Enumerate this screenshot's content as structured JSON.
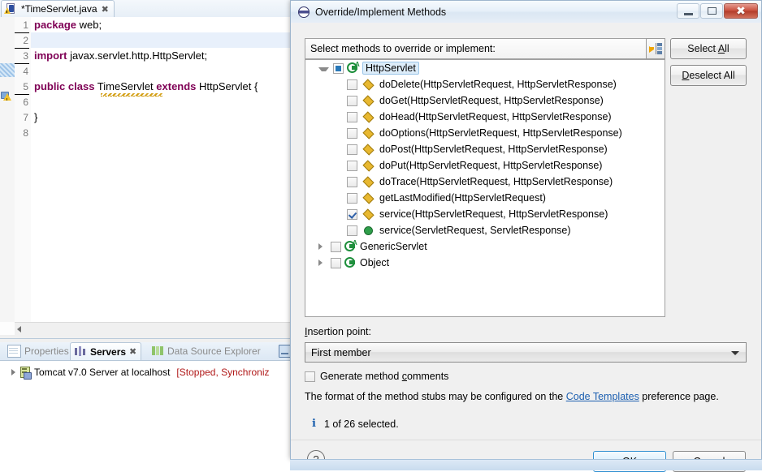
{
  "editor": {
    "tab": {
      "label": "*TimeServlet.java",
      "close_glyph": "✖",
      "icon": "java-file-warning-icon"
    },
    "line_numbers": [
      "1",
      "2",
      "3",
      "4",
      "5",
      "6",
      "7",
      "8"
    ],
    "lines": [
      {
        "n": 1,
        "tokens": [
          {
            "t": "package",
            "k": "kw"
          },
          {
            "t": " web;",
            "k": "pl"
          }
        ]
      },
      {
        "n": 2,
        "tokens": []
      },
      {
        "n": 3,
        "tokens": [
          {
            "t": "import",
            "k": "kw"
          },
          {
            "t": " javax.servlet.http.HttpServlet;",
            "k": "pl"
          }
        ]
      },
      {
        "n": 4,
        "tokens": []
      },
      {
        "n": 5,
        "tokens": [
          {
            "t": "public class",
            "k": "kw"
          },
          {
            "t": " TimeServlet ",
            "k": "pl"
          },
          {
            "t": "extends",
            "k": "kw"
          },
          {
            "t": " HttpServlet {",
            "k": "pl"
          }
        ]
      },
      {
        "n": 6,
        "tokens": []
      },
      {
        "n": 7,
        "tokens": [
          {
            "t": "}",
            "k": "pl"
          }
        ]
      },
      {
        "n": 8,
        "tokens": []
      }
    ],
    "keyword_color": "#7f0055",
    "plain_color": "#000000"
  },
  "views": {
    "tabs": [
      {
        "label": "Properties",
        "icon": "properties-icon",
        "active": false
      },
      {
        "label": "Servers",
        "icon": "servers-icon",
        "active": true,
        "close_glyph": "✖"
      },
      {
        "label": "Data Source Explorer",
        "icon": "data-source-explorer-icon",
        "active": false
      },
      {
        "label": "",
        "icon": "console-icon",
        "active": false
      }
    ],
    "server_row": {
      "name": "Tomcat v7.0 Server at localhost",
      "status": "[Stopped, Synchroniz",
      "status_color": "#b01818"
    }
  },
  "dialog": {
    "title": "Override/Implement Methods",
    "window_buttons": {
      "minimize": "minimize-button",
      "maximize": "maximize-button",
      "close_glyph": "✖"
    },
    "tree_header_label": "Select methods to override or implement:",
    "link_button_name": "link-with-editor-button",
    "select_all_label": "Select All",
    "select_all_mnemonic": "A",
    "deselect_all_label": "Deselect All",
    "deselect_all_mnemonic": "D",
    "tree": [
      {
        "label": "HttpServlet",
        "kind": "class",
        "abstract": true,
        "indent": 0,
        "twisty": "open",
        "checkbox": "partial",
        "selected": true
      },
      {
        "label": "doDelete(HttpServletRequest, HttpServletResponse)",
        "kind": "method",
        "visibility": "protected",
        "indent": 1,
        "twisty": "none",
        "checkbox": "unchecked",
        "selected": false
      },
      {
        "label": "doGet(HttpServletRequest, HttpServletResponse)",
        "kind": "method",
        "visibility": "protected",
        "indent": 1,
        "twisty": "none",
        "checkbox": "unchecked",
        "selected": false
      },
      {
        "label": "doHead(HttpServletRequest, HttpServletResponse)",
        "kind": "method",
        "visibility": "protected",
        "indent": 1,
        "twisty": "none",
        "checkbox": "unchecked",
        "selected": false
      },
      {
        "label": "doOptions(HttpServletRequest, HttpServletResponse)",
        "kind": "method",
        "visibility": "protected",
        "indent": 1,
        "twisty": "none",
        "checkbox": "unchecked",
        "selected": false
      },
      {
        "label": "doPost(HttpServletRequest, HttpServletResponse)",
        "kind": "method",
        "visibility": "protected",
        "indent": 1,
        "twisty": "none",
        "checkbox": "unchecked",
        "selected": false
      },
      {
        "label": "doPut(HttpServletRequest, HttpServletResponse)",
        "kind": "method",
        "visibility": "protected",
        "indent": 1,
        "twisty": "none",
        "checkbox": "unchecked",
        "selected": false
      },
      {
        "label": "doTrace(HttpServletRequest, HttpServletResponse)",
        "kind": "method",
        "visibility": "protected",
        "indent": 1,
        "twisty": "none",
        "checkbox": "unchecked",
        "selected": false
      },
      {
        "label": "getLastModified(HttpServletRequest)",
        "kind": "method",
        "visibility": "protected",
        "indent": 1,
        "twisty": "none",
        "checkbox": "unchecked",
        "selected": false
      },
      {
        "label": "service(HttpServletRequest, HttpServletResponse)",
        "kind": "method",
        "visibility": "protected",
        "indent": 1,
        "twisty": "none",
        "checkbox": "checked",
        "selected": false
      },
      {
        "label": "service(ServletRequest, ServletResponse)",
        "kind": "method",
        "visibility": "public",
        "indent": 1,
        "twisty": "none",
        "checkbox": "unchecked",
        "selected": false
      },
      {
        "label": "GenericServlet",
        "kind": "class",
        "abstract": true,
        "indent": 0,
        "twisty": "closed",
        "checkbox": "unchecked",
        "selected": false
      },
      {
        "label": "Object",
        "kind": "class",
        "abstract": false,
        "indent": 0,
        "twisty": "closed",
        "checkbox": "unchecked",
        "selected": false
      }
    ],
    "insertion_point_label": "Insertion point:",
    "insertion_point_mnemonic": "I",
    "insertion_point_value": "First member",
    "generate_comments_label": "Generate method comments",
    "generate_comments_checked": false,
    "format_note_prefix": "The format of the method stubs may be configured on the ",
    "format_note_link": "Code Templates",
    "format_note_suffix": " preference page.",
    "status_text": "1 of 26 selected.",
    "info_glyph": "i",
    "help_glyph": "?",
    "ok_label": "OK",
    "cancel_label": "Cancel"
  }
}
